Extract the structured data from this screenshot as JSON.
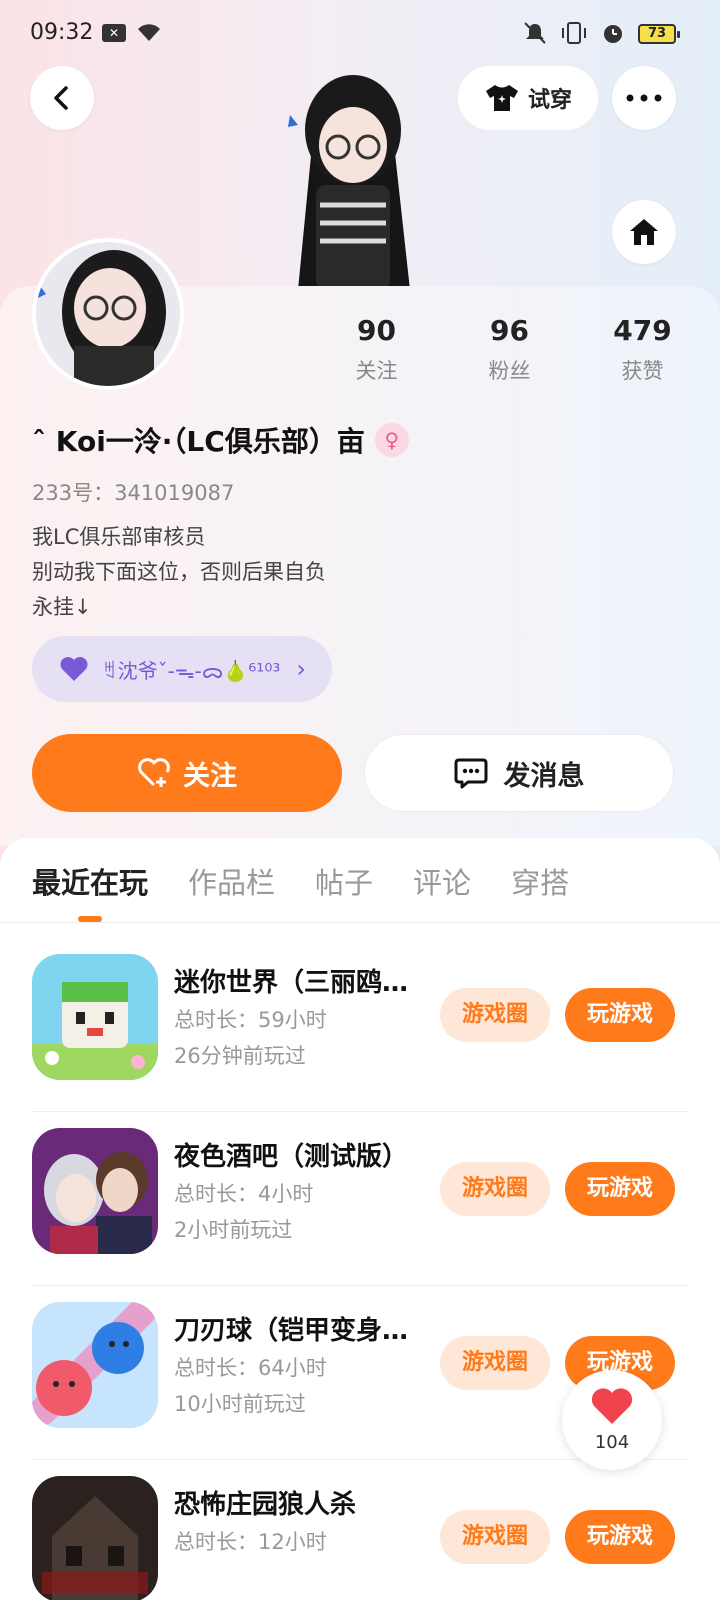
{
  "status_bar": {
    "time": "09:32",
    "battery": "73"
  },
  "header": {
    "try_on_label": "试穿"
  },
  "profile": {
    "stats": [
      {
        "value": "90",
        "label": "关注"
      },
      {
        "value": "96",
        "label": "粉丝"
      },
      {
        "value": "479",
        "label": "获赞"
      }
    ],
    "username": "ˆ Koi一泠·（LC俱乐部）亩",
    "id_line": "233号：341019087",
    "bio": [
      "我LC俱乐部审核员",
      "别动我下面这位，否则后果自负",
      "永挂↓"
    ],
    "badge_text": "ꒄ沈爷ˇ-ᯓ-ᯅ🍐⁶¹⁰³"
  },
  "actions": {
    "follow_label": "关注",
    "message_label": "发消息"
  },
  "tabs": [
    "最近在玩",
    "作品栏",
    "帖子",
    "评论",
    "穿搭"
  ],
  "games": [
    {
      "title": "迷你世界（三丽鸥…",
      "duration": "总时长：59小时",
      "last_played": "26分钟前玩过",
      "circle_label": "游戏圈",
      "play_label": "玩游戏"
    },
    {
      "title": "夜色酒吧（测试版）",
      "duration": "总时长：4小时",
      "last_played": "2小时前玩过",
      "circle_label": "游戏圈",
      "play_label": "玩游戏"
    },
    {
      "title": "刀刃球（铠甲变身…",
      "duration": "总时长：64小时",
      "last_played": "10小时前玩过",
      "circle_label": "游戏圈",
      "play_label": "玩游戏"
    },
    {
      "title": "恐怖庄园狼人杀",
      "duration": "总时长：12小时",
      "last_played": "",
      "circle_label": "游戏圈",
      "play_label": "玩游戏"
    }
  ],
  "like_float": {
    "count": "104"
  },
  "colors": {
    "accent": "#ff7a1a",
    "accent_light": "#ffe7d8",
    "badge_purple": "#7a5ad6"
  }
}
